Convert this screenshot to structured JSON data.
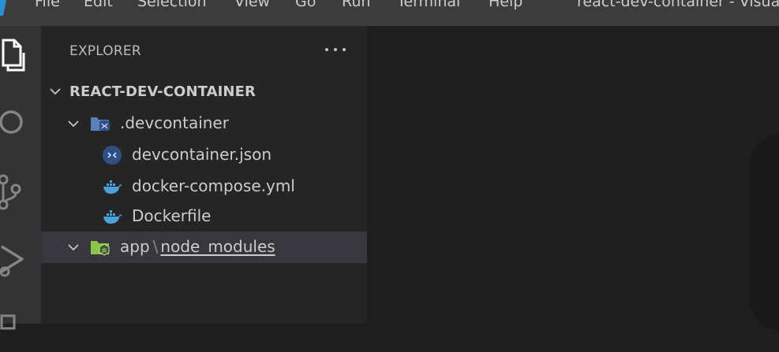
{
  "titlebar": {
    "menu": [
      "File",
      "Edit",
      "Selection",
      "View",
      "Go",
      "Run",
      "Terminal",
      "Help"
    ],
    "window_title": "react-dev-container - Visua"
  },
  "activitybar": {
    "icons": [
      "explorer-icon",
      "search-icon",
      "source-control-icon",
      "run-debug-icon",
      "extensions-icon"
    ]
  },
  "sidebar": {
    "header": "EXPLORER",
    "root": "REACT-DEV-CONTAINER",
    "tree": [
      {
        "label": ".devcontainer",
        "icon": "devcontainer-folder-icon",
        "expanded": true
      },
      {
        "label": "devcontainer.json",
        "icon": "devcontainer-file-icon"
      },
      {
        "label": "docker-compose.yml",
        "icon": "docker-icon"
      },
      {
        "label": "Dockerfile",
        "icon": "docker-icon"
      }
    ],
    "compact_folder": {
      "parent": "app",
      "separator": "\\",
      "child": "node_modules",
      "icon": "node-folder-icon"
    }
  },
  "colors": {
    "titlebar": "#3c3c3c",
    "activitybar": "#333333",
    "sidebar": "#252526",
    "editor": "#1e1e1e",
    "selected_row": "#37373d",
    "docker_blue": "#4aa2d8"
  }
}
